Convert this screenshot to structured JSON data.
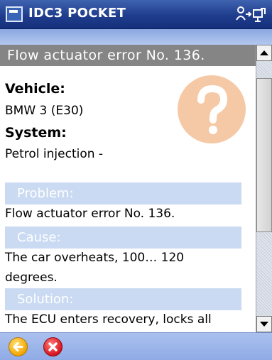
{
  "app": {
    "title": "IDC3 POCKET",
    "icons": [
      "app-icon",
      "connectivity-icon",
      "sync-icon"
    ]
  },
  "header": {
    "title": "Flow actuator error No. 136."
  },
  "details": {
    "vehicle_label": "Vehicle:",
    "vehicle_value": "BMW 3 (E30)",
    "system_label": "System:",
    "system_value": "Petrol injection -"
  },
  "sections": {
    "problem_label": "Problem:",
    "problem_text": "Flow actuator error No. 136.",
    "cause_label": "Cause:",
    "cause_text_1": "The car overheats, 100… 120",
    "cause_text_2": "degrees.",
    "solution_label": "Solution:",
    "solution_text": "The ECU enters recovery, locks all"
  },
  "colors": {
    "titlebar": "#1f3d8d",
    "header_bg": "#858585",
    "section_bg": "#c9daf2",
    "watermark": "#f6c9a6",
    "back": "#f2a600",
    "close": "#d8141d"
  },
  "toolbar": {
    "icons": [
      "back-arrow-icon",
      "close-icon"
    ]
  }
}
